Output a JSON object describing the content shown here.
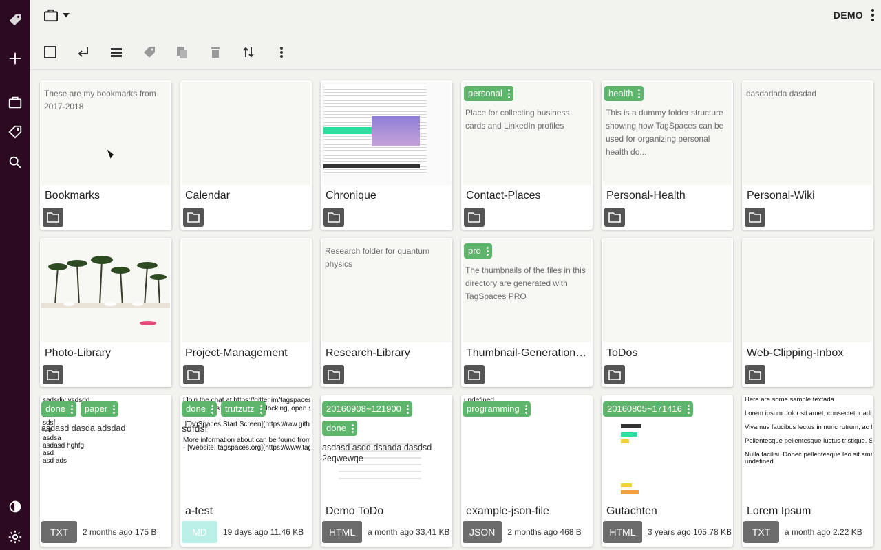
{
  "topbar": {
    "workspace_label": "DEMO"
  },
  "folders": [
    {
      "title": "Bookmarks",
      "description": "These are my bookmarks from 2017-2018",
      "tags": []
    },
    {
      "title": "Calendar",
      "description": "",
      "tags": []
    },
    {
      "title": "Chronique",
      "description": "",
      "tags": []
    },
    {
      "title": "Contact-Places",
      "description": "Place for collecting business cards and LinkedIn profiles",
      "tags": [
        "personal"
      ]
    },
    {
      "title": "Personal-Health",
      "description": "This is a dummy folder structure showing how TagSpaces can be used for organizing personal health do...",
      "tags": [
        "health"
      ]
    },
    {
      "title": "Personal-Wiki",
      "description": "dasdadada dasdad",
      "tags": []
    },
    {
      "title": "Photo-Library",
      "description": "",
      "tags": []
    },
    {
      "title": "Project-Management",
      "description": "",
      "tags": []
    },
    {
      "title": "Research-Library",
      "description": "Research folder for quantum physics",
      "tags": []
    },
    {
      "title": "Thumbnail-Generation-...",
      "description": "The thumbnails of the files in this directory are generated with TagSpaces PRO",
      "tags": [
        "pro"
      ]
    },
    {
      "title": "ToDos",
      "description": "",
      "tags": []
    },
    {
      "title": "Web-Clipping-Inbox",
      "description": "",
      "tags": []
    }
  ],
  "files": [
    {
      "title": "",
      "ext": "TXT",
      "meta": "2 months ago 175 B",
      "tags": [
        "done",
        "paper"
      ],
      "preview": "sadsdiv vsdsdd\nt\nads\nsdsf\nsdf\nasdsa\nasdasd hghfg\nasd\nasd ads",
      "desc": "asdasd dasda adsdad"
    },
    {
      "title": "a-test",
      "ext": "MD",
      "meta": "19 days ago 11.46 KB",
      "tags": [
        "done",
        "trutzutz"
      ],
      "preview": "[Join the chat at https://gitter.im/tagspaces/ta\n\"TagSpaces\" is a free, non-locking, open so\n\n![TagSpaces Start Screen](https://raw.githubu\n\nMore information about can be found from the\n- [Website: tagspaces.org](https://www.tagspa",
      "desc": "sdfdsf"
    },
    {
      "title": "Demo ToDo",
      "ext": "HTML",
      "meta": "a month ago 33.41 KB",
      "tags": [
        "20160908~121900",
        "done"
      ],
      "preview": "",
      "desc": "asdasd asdd dsaada dasdsd 2eqwewqe"
    },
    {
      "title": "example-json-file",
      "ext": "JSON",
      "meta": "2 months ago 468 B",
      "tags": [
        "programming"
      ],
      "preview": "undefined",
      "desc": ""
    },
    {
      "title": "Gutachten",
      "ext": "HTML",
      "meta": "3 years ago 105.78 KB",
      "tags": [
        "20160805~171416"
      ],
      "preview": "",
      "desc": ""
    },
    {
      "title": "Lorem Ipsum",
      "ext": "TXT",
      "meta": "a month ago 2.22 KB",
      "tags": [],
      "preview": "Here are some sample textada\n\nLorem ipsum dolor sit amet, consectetur adip\n\nVivamus faucibus lectus in nunc rutrum, ac fa\n\nPellentesque pellentesque luctus tristique. Su\n\nNulla facilisi. Donec pellentesque leo sit amet\nundefined",
      "desc": ""
    }
  ]
}
